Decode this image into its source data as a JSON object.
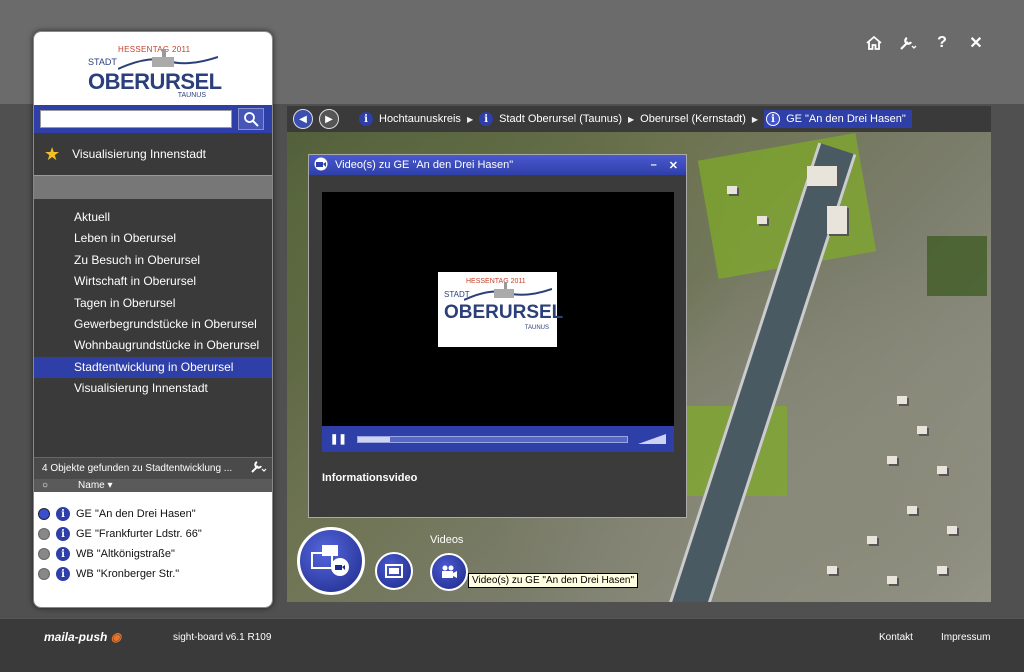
{
  "header": {
    "icons": [
      "home-icon",
      "wrench-icon",
      "help-icon",
      "close-icon"
    ],
    "help_glyph": "?",
    "close_glyph": "✕"
  },
  "sidebar": {
    "logo": {
      "hessentag": "HESSENTAG 2011",
      "stadt": "STADT",
      "name": "OBERURSEL",
      "taunus": "TAUNUS"
    },
    "search": {
      "placeholder": "",
      "value": ""
    },
    "favorite": "Visualisierung Innenstadt",
    "menu": [
      {
        "label": "Aktuell"
      },
      {
        "label": "Leben in Oberursel"
      },
      {
        "label": "Zu Besuch in Oberursel"
      },
      {
        "label": "Wirtschaft in Oberursel"
      },
      {
        "label": "Tagen in Oberursel"
      },
      {
        "label": "Gewerbegrundstücke in Oberursel"
      },
      {
        "label": "Wohnbaugrundstücke in Oberursel"
      },
      {
        "label": "Stadtentwicklung in Oberursel",
        "active": true
      },
      {
        "label": "Visualisierung Innenstadt"
      }
    ],
    "result_text": "4 Objekte gefunden zu Stadtentwicklung ...",
    "columns": {
      "radio": "○",
      "name": "Name"
    },
    "results": [
      {
        "label": "GE \"An den Drei Hasen\"",
        "selected": true
      },
      {
        "label": "GE \"Frankfurter Ldstr. 66\"",
        "selected": false
      },
      {
        "label": "WB \"Altkönigstraße\"",
        "selected": false
      },
      {
        "label": "WB \"Kronberger Str.\"",
        "selected": false
      }
    ]
  },
  "breadcrumb": [
    {
      "label": "Hochtaunuskreis"
    },
    {
      "label": "Stadt Oberursel (Taunus)"
    },
    {
      "label": "Oberursel (Kernstadt)"
    },
    {
      "label": "GE \"An den Drei Hasen\"",
      "active": true
    }
  ],
  "video_window": {
    "title": "Video(s) zu GE \"An den Drei Hasen\"",
    "minimize": "–",
    "close": "✕",
    "caption": "Informationsvideo",
    "progress": 0.12,
    "play_glyph": "❚❚"
  },
  "floating": {
    "videos_label": "Videos",
    "tooltip": "Video(s) zu GE \"An den Drei Hasen\""
  },
  "footer": {
    "brand": "maila-push",
    "version": "sight-board v6.1 R109",
    "kontakt": "Kontakt",
    "impressum": "Impressum"
  },
  "colors": {
    "accent": "#2f3fa8",
    "star": "#f4c020"
  }
}
